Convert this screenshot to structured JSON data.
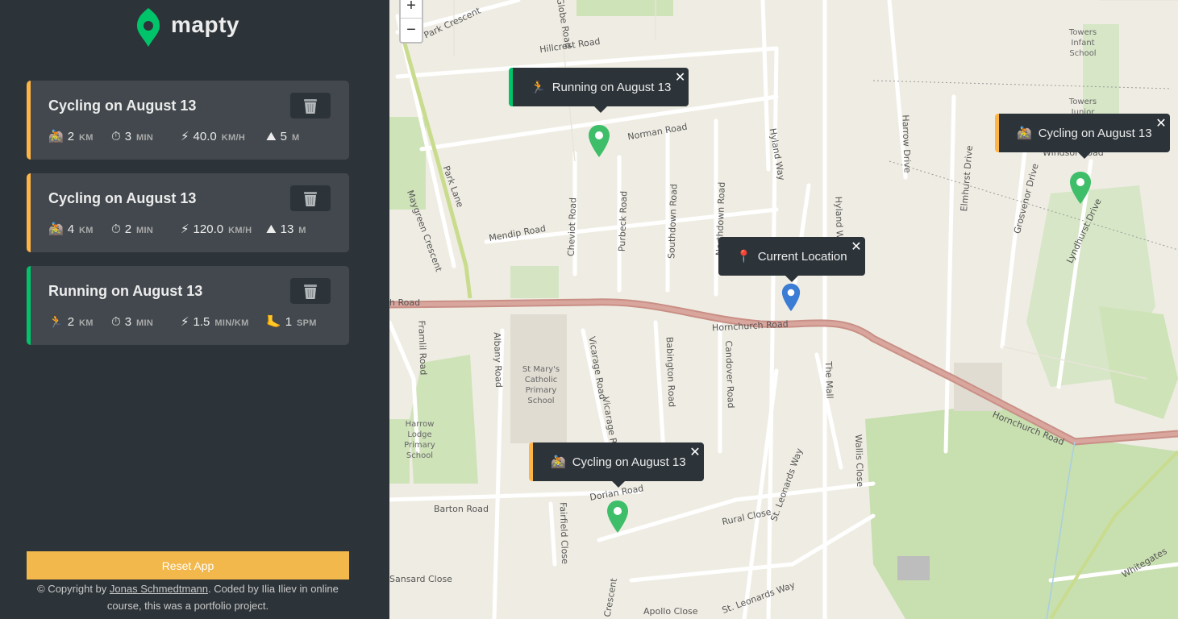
{
  "app": {
    "name": "mapty"
  },
  "workouts": [
    {
      "type": "cycling",
      "title": "Cycling on August 13",
      "stats": [
        {
          "icon": "🚵",
          "value": "2",
          "unit": "km"
        },
        {
          "icon": "⏱",
          "value": "3",
          "unit": "min"
        },
        {
          "icon": "⚡",
          "value": "40.0",
          "unit": "km/h"
        },
        {
          "icon": "⛰",
          "value": "5",
          "unit": "m"
        }
      ]
    },
    {
      "type": "cycling",
      "title": "Cycling on August 13",
      "stats": [
        {
          "icon": "🚵",
          "value": "4",
          "unit": "km"
        },
        {
          "icon": "⏱",
          "value": "2",
          "unit": "min"
        },
        {
          "icon": "⚡",
          "value": "120.0",
          "unit": "km/h"
        },
        {
          "icon": "⛰",
          "value": "13",
          "unit": "m"
        }
      ]
    },
    {
      "type": "running",
      "title": "Running on August 13",
      "stats": [
        {
          "icon": "🏃",
          "value": "2",
          "unit": "km"
        },
        {
          "icon": "⏱",
          "value": "3",
          "unit": "min"
        },
        {
          "icon": "⚡",
          "value": "1.5",
          "unit": "min/km"
        },
        {
          "icon": "🦶",
          "value": "1",
          "unit": "spm"
        }
      ]
    }
  ],
  "footer": {
    "reset_label": "Reset App",
    "copyright_prefix": "© Copyright by ",
    "author": "Jonas Schmedtmann",
    "copyright_suffix": ". Coded by Ilia Iliev in online course, this was a portfolio project."
  },
  "map": {
    "zoom_in": "+",
    "zoom_out": "−",
    "close_glyph": "✕",
    "popups": [
      {
        "kind": "run",
        "icon": "🏃",
        "text": "Running on August 13"
      },
      {
        "kind": "cyc",
        "icon": "🚵",
        "text": "Cycling on August 13"
      },
      {
        "kind": "plain",
        "icon": "📍",
        "text": "Current Location"
      },
      {
        "kind": "cyc",
        "icon": "🚵",
        "text": "Cycling on August 13"
      }
    ],
    "roads": [
      "Park Crescent",
      "Hillcrest Road",
      "Globe Road",
      "Norman Road",
      "Hyland Way",
      "Harrow Drive",
      "Elmhurst Drive",
      "Grosvenor Drive",
      "Lyndhurst Drive",
      "Windsor Road",
      "Maygreen Crescent",
      "Park Lane",
      "Mendip Road",
      "Cheviot Road",
      "Purbeck Road",
      "Southdown Road",
      "Northdown Road",
      "Hornchurch Road",
      "Framlil Road",
      "Albany Road",
      "Vicarage Road",
      "Babington Road",
      "Candover Road",
      "The Mall",
      "Wallis Close",
      "Hornchurch Road",
      "Barton Road",
      "Dorian Road",
      "Fairfield Close",
      "Rural Close",
      "St. Leonards Way",
      "Whitegates",
      "Apollo Close",
      "Sansard Close",
      "Vicarage Road",
      "St. Leonards Way",
      "Hyland Way",
      "Crescent",
      "h Road"
    ],
    "places": [
      "Towers Infant School",
      "Towers Junior",
      "St Mary's Catholic Primary School",
      "Harrow Lodge Primary School"
    ]
  },
  "colors": {
    "cycling": "#ffb545",
    "running": "#00c46a",
    "sidebar": "#2d3439",
    "card": "#42484d",
    "reset": "#f2b84b"
  }
}
